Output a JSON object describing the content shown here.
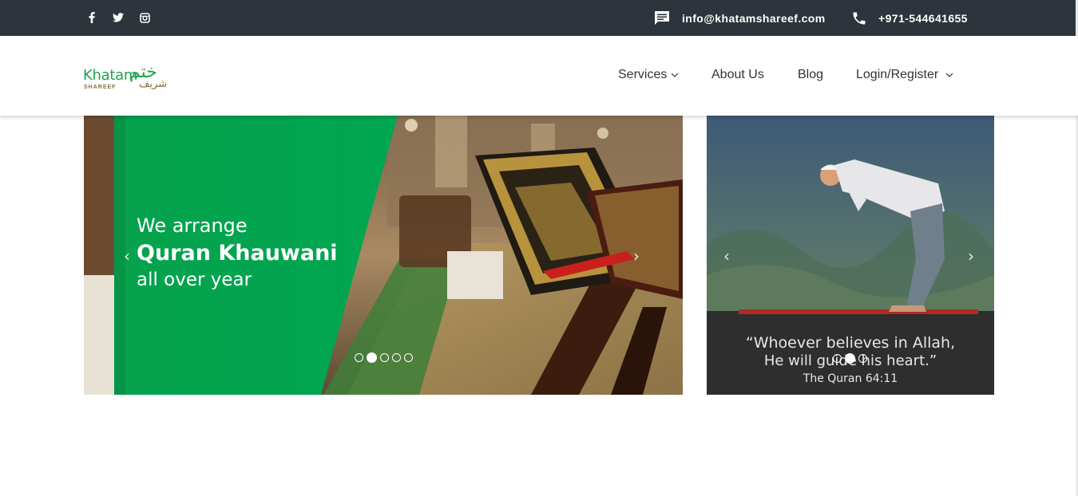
{
  "topbar": {
    "social": [
      {
        "name": "facebook-icon"
      },
      {
        "name": "twitter-icon"
      },
      {
        "name": "instagram-icon"
      }
    ],
    "email": "info@khatamshareef.com",
    "phone": "+971-544641655"
  },
  "logo": {
    "latin": "Khatam",
    "sub": "SHAREEF",
    "arabic": "ختم",
    "arabic_sub": "شریف"
  },
  "nav": {
    "services": "Services",
    "about": "About Us",
    "blog": "Blog",
    "login": "Login/Register"
  },
  "slider_main": {
    "line1": "We arrange",
    "line2": "Quran Khauwani",
    "line3": "all over year",
    "prev": "‹",
    "next": "›",
    "dots": 5,
    "active_dot": 2
  },
  "slider_side": {
    "quote1": "“Whoever believes in Allah,",
    "quote2": "He will guide his heart.”",
    "source": "The Quran 64:11",
    "prev": "‹",
    "next": "›",
    "dots": 3,
    "active_dot": 2
  },
  "colors": {
    "topbar": "#2d343b",
    "brand_green": "#00a651",
    "logo_green": "#1ea44a"
  }
}
